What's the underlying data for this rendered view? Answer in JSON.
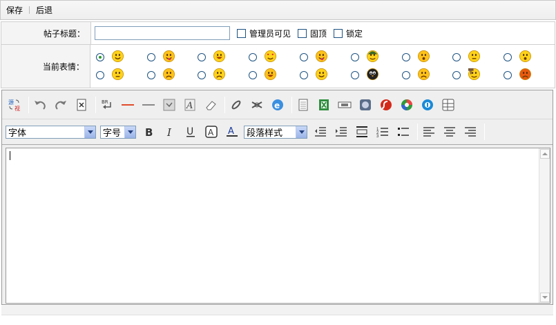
{
  "toolbar": {
    "save": "保存",
    "back": "后退"
  },
  "form": {
    "title_label": "帖子标题：",
    "title_value": "",
    "options": [
      {
        "label": "管理员可见",
        "checked": false
      },
      {
        "label": "固顶",
        "checked": false
      },
      {
        "label": "锁定",
        "checked": false
      }
    ],
    "face_label": "当前表情：",
    "faces": [
      {
        "name": "smile",
        "selected": true
      },
      {
        "name": "shy",
        "selected": false
      },
      {
        "name": "grin",
        "selected": false
      },
      {
        "name": "love",
        "selected": false
      },
      {
        "name": "tongue",
        "selected": false
      },
      {
        "name": "soldier",
        "selected": false
      },
      {
        "name": "surprised",
        "selected": false
      },
      {
        "name": "cool",
        "selected": false
      },
      {
        "name": "confused",
        "selected": false
      },
      {
        "name": "thinking",
        "selected": false
      },
      {
        "name": "sad",
        "selected": false
      },
      {
        "name": "crying",
        "selected": false
      },
      {
        "name": "laughing",
        "selected": false
      },
      {
        "name": "wink",
        "selected": false
      },
      {
        "name": "penguin",
        "selected": false
      },
      {
        "name": "unhappy",
        "selected": false
      },
      {
        "name": "hammer",
        "selected": false
      },
      {
        "name": "angry",
        "selected": false
      }
    ]
  },
  "editor": {
    "font_select": "字体",
    "size_select": "字号",
    "para_select": "段落样式",
    "content": ""
  },
  "colors": {
    "accent_red": "#e04a2a",
    "border": "#cfcfcf",
    "label_bg": "#f4f4f4"
  }
}
